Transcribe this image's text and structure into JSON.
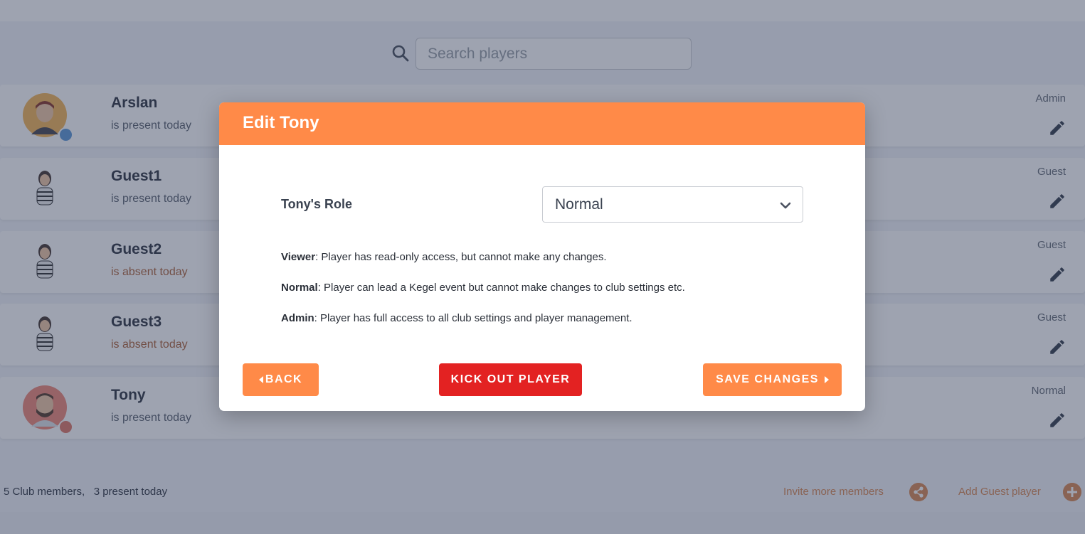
{
  "search": {
    "placeholder": "Search players"
  },
  "players": [
    {
      "name": "Arslan",
      "status": "is present today",
      "role": "Admin",
      "present": true
    },
    {
      "name": "Guest1",
      "status": "is present today",
      "role": "Guest",
      "present": true
    },
    {
      "name": "Guest2",
      "status": "is absent today",
      "role": "Guest",
      "present": false
    },
    {
      "name": "Guest3",
      "status": "is absent today",
      "role": "Guest",
      "present": false
    },
    {
      "name": "Tony",
      "status": "is present today",
      "role": "Normal",
      "present": true
    }
  ],
  "footer": {
    "count_text": "5 Club members,   3 present today",
    "invite_label": "Invite more members",
    "add_guest_label": "Add Guest player"
  },
  "modal": {
    "title": "Edit Tony",
    "role_label": "Tony's Role",
    "role_selected": "Normal",
    "descriptions": [
      {
        "term": "Viewer",
        "text": ": Player has read-only access, but cannot make any changes."
      },
      {
        "term": "Normal",
        "text": ": Player can lead a Kegel event but cannot make changes to club settings etc."
      },
      {
        "term": "Admin",
        "text": ": Player has full access to all club settings and player management."
      }
    ],
    "back_label": "BACK",
    "kick_label": "KICK OUT PLAYER",
    "save_label": "SAVE CHANGES"
  },
  "colors": {
    "accent": "#ff8a48",
    "danger": "#e32222",
    "presence_present": "#5f9ad8",
    "presence_tony": "#e07b6a"
  }
}
